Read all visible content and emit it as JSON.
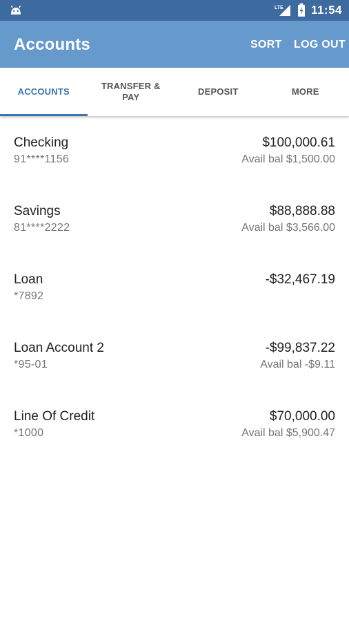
{
  "status_bar": {
    "notification_icon": "android-icon",
    "network_label": "LTE",
    "time": "11:54"
  },
  "app_bar": {
    "title": "Accounts",
    "sort_label": "SORT",
    "logout_label": "LOG OUT"
  },
  "tabs": [
    {
      "label": "ACCOUNTS",
      "active": true
    },
    {
      "label": "TRANSFER & PAY",
      "active": false
    },
    {
      "label": "DEPOSIT",
      "active": false
    },
    {
      "label": "MORE",
      "active": false
    }
  ],
  "accounts": [
    {
      "name": "Checking",
      "number": "91****1156",
      "balance": "$100,000.61",
      "available": "Avail bal $1,500.00"
    },
    {
      "name": "Savings",
      "number": "81****2222",
      "balance": "$88,888.88",
      "available": "Avail bal $3,566.00"
    },
    {
      "name": "Loan",
      "number": "*7892",
      "balance": "-$32,467.19",
      "available": ""
    },
    {
      "name": "Loan Account 2",
      "number": "*95-01",
      "balance": "-$99,837.22",
      "available": "Avail bal -$9.11"
    },
    {
      "name": "Line Of Credit",
      "number": "*1000",
      "balance": "$70,000.00",
      "available": "Avail bal $5,900.47"
    }
  ],
  "colors": {
    "status_bar": "#3d6a9f",
    "app_bar": "#6699cc",
    "accent": "#3c73b0"
  }
}
